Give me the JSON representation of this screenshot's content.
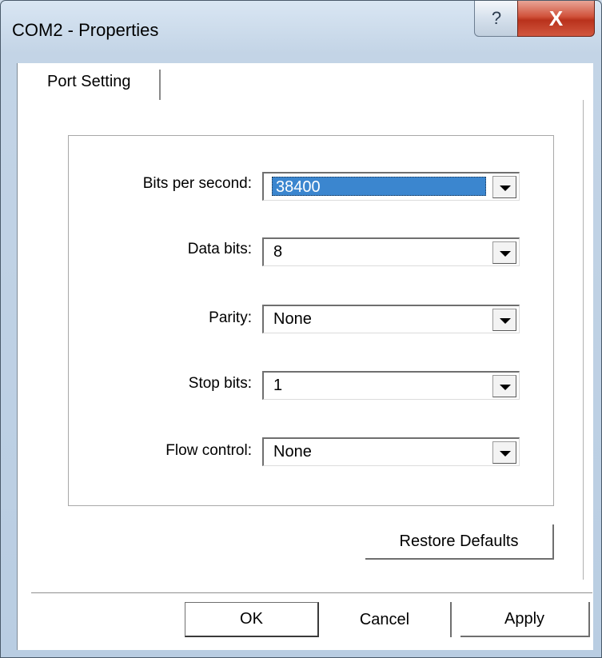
{
  "window": {
    "title": "COM2 - Properties",
    "help_glyph": "?",
    "close_glyph": "X"
  },
  "tabs": [
    {
      "label": "Port Setting"
    }
  ],
  "settings": [
    {
      "label": "Bits per second:",
      "value": "38400",
      "selected": true
    },
    {
      "label": "Data bits:",
      "value": "8"
    },
    {
      "label": "Parity:",
      "value": "None"
    },
    {
      "label": "Stop bits:",
      "value": "1"
    },
    {
      "label": "Flow control:",
      "value": "None"
    }
  ],
  "buttons": {
    "restore_defaults": "Restore Defaults",
    "ok": "OK",
    "cancel": "Cancel",
    "apply": "Apply"
  },
  "colors": {
    "selection": "#3b86cf",
    "close_button": "#c8422b"
  }
}
